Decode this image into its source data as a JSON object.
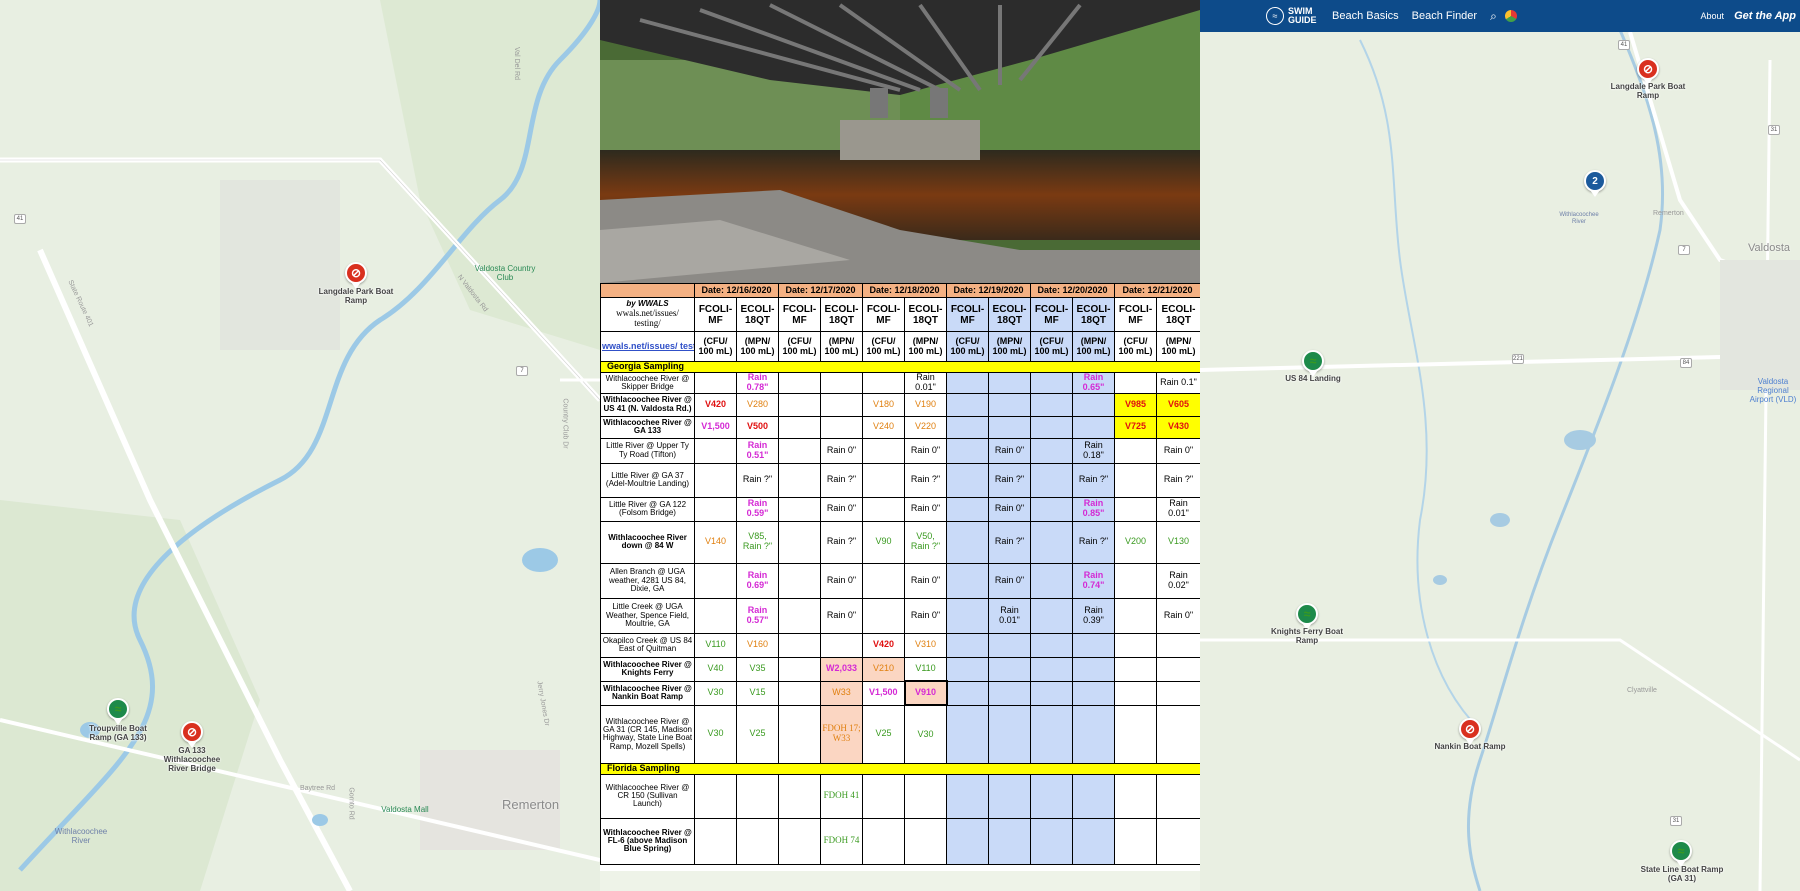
{
  "header": {
    "brand": "SWIM GUIDE",
    "nav": [
      "Beach Basics",
      "Beach Finder"
    ],
    "about": "About",
    "cta": "Get the App"
  },
  "map_left": {
    "markers": [
      {
        "name": "langdale-park-boat-ramp-marker",
        "label": "Langdale Park Boat Ramp",
        "status": "red"
      },
      {
        "name": "troupville-boat-ramp-marker",
        "label": "Troupville Boat Ramp (GA 133)",
        "status": "green"
      },
      {
        "name": "ga133-marker",
        "label": "GA 133 Withlacoochee River Bridge",
        "status": "red"
      }
    ],
    "places": {
      "remerton": "Remerton",
      "river": "Withlacoochee River",
      "mall": "Valdosta Mall",
      "club": "Valdosta Country Club"
    },
    "roads": [
      "N Valdosta Rd",
      "State Route 401",
      "Baytree Rd",
      "Gornto Rd",
      "Jerry Jones Dr",
      "Country Club Dr",
      "Val Del Rd"
    ],
    "shields": [
      "41",
      "7",
      "41"
    ]
  },
  "map_right": {
    "markers": [
      {
        "name": "langdale-park-marker",
        "label": "Langdale Park Boat Ramp",
        "status": "red"
      },
      {
        "name": "cluster-marker",
        "label": "2",
        "status": "blue"
      },
      {
        "name": "us84-landing-marker",
        "label": "US 84 Landing",
        "status": "green"
      },
      {
        "name": "knights-ferry-marker",
        "label": "Knights Ferry Boat Ramp",
        "status": "green"
      },
      {
        "name": "nankin-marker",
        "label": "Nankin Boat Ramp",
        "status": "red"
      },
      {
        "name": "state-line-marker",
        "label": "State Line Boat Ramp (GA 31)",
        "status": "green"
      }
    ],
    "places": {
      "valdosta": "Valdosta",
      "remerton": "Remerton",
      "clyattville": "Clyattville",
      "airport": "Valdosta Regional Airport (VLD)",
      "withla": "Withlacoochee River"
    },
    "shields": [
      "41",
      "31",
      "7",
      "221",
      "84",
      "31"
    ]
  },
  "table": {
    "by": "by WWALS",
    "site": "wwals.net/issues/ testing/",
    "link": "wwals.net/issues/ testing/",
    "dates": [
      "Date:  12/16/2020",
      "Date:  12/17/2020",
      "Date:  12/18/2020",
      "Date:  12/19/2020",
      "Date:  12/20/2020",
      "Date:  12/21/2020"
    ],
    "col_headers": [
      "FCOLI-MF",
      "ECOLI-18QT"
    ],
    "units": [
      "(CFU/ 100 mL)",
      "(MPN/ 100 mL)"
    ],
    "georgia": "Georgia Sampling",
    "florida": "Florida Sampling",
    "rows": [
      {
        "site": "Withlacoochee River @ Skipper Bridge",
        "cells": [
          "",
          "Rain 0.78\"",
          "",
          "",
          "",
          "Rain 0.01\"",
          "",
          "",
          "",
          "Rain 0.65\"",
          "",
          "Rain 0.1\""
        ]
      },
      {
        "site": "Withlacoochee River @ US 41 (N. Valdosta Rd.)",
        "cells": [
          "V420",
          "V280",
          "",
          "",
          "V180",
          "V190",
          "",
          "",
          "",
          "",
          "V985",
          "V605"
        ]
      },
      {
        "site": "Withlacoochee River @ GA 133",
        "cells": [
          "V1,500",
          "V500",
          "",
          "",
          "V240",
          "V220",
          "",
          "",
          "",
          "",
          "V725",
          "V430"
        ]
      },
      {
        "site": "Little River @ Upper Ty Ty Road (Tifton)",
        "cells": [
          "",
          "Rain 0.51\"",
          "",
          "Rain 0\"",
          "",
          "Rain 0\"",
          "",
          "Rain 0\"",
          "",
          "Rain 0.18\"",
          "",
          "Rain 0\""
        ]
      },
      {
        "site": "Little River @ GA 37 (Adel-Moultrie Landing)",
        "cells": [
          "",
          "Rain ?\"",
          "",
          "Rain ?\"",
          "",
          "Rain ?\"",
          "",
          "Rain ?\"",
          "",
          "Rain ?\"",
          "",
          "Rain ?\""
        ]
      },
      {
        "site": "Little River @ GA 122 (Folsom Bridge)",
        "cells": [
          "",
          "Rain 0.59\"",
          "",
          "Rain 0\"",
          "",
          "Rain 0\"",
          "",
          "Rain 0\"",
          "",
          "Rain 0.85\"",
          "",
          "Rain 0.01\""
        ]
      },
      {
        "site": "Withlacoochee River down @ 84 W",
        "cells": [
          "V140",
          "V85, Rain ?\"",
          "",
          "Rain ?\"",
          "V90",
          "V50, Rain ?\"",
          "",
          "Rain ?\"",
          "",
          "Rain ?\"",
          "V200",
          "V130"
        ]
      },
      {
        "site": "Allen Branch @ UGA weather, 4281 US 84, Dixie, GA",
        "cells": [
          "",
          "Rain 0.69\"",
          "",
          "Rain 0\"",
          "",
          "Rain 0\"",
          "",
          "Rain 0\"",
          "",
          "Rain 0.74\"",
          "",
          "Rain 0.02\""
        ]
      },
      {
        "site": "Little Creek @ UGA Weather, Spence Field, Moultrie, GA",
        "cells": [
          "",
          "Rain 0.57\"",
          "",
          "Rain 0\"",
          "",
          "Rain 0\"",
          "",
          "Rain 0.01\"",
          "",
          "Rain 0.39\"",
          "",
          "Rain 0\""
        ]
      },
      {
        "site": "Okapilco Creek @ US 84 East of Quitman",
        "cells": [
          "V110",
          "V160",
          "",
          "",
          "V420",
          "V310",
          "",
          "",
          "",
          "",
          "",
          ""
        ]
      },
      {
        "site": "Withlacoochee River @ Knights Ferry",
        "cells": [
          "V40",
          "V35",
          "",
          "W2,033",
          "V210",
          "V110",
          "",
          "",
          "",
          "",
          "",
          ""
        ]
      },
      {
        "site": "Withlacoochee River @ Nankin Boat Ramp",
        "cells": [
          "V30",
          "V15",
          "",
          "W33",
          "V1,500",
          "V910",
          "",
          "",
          "",
          "",
          "",
          ""
        ]
      },
      {
        "site": "Withlacoochee River @ GA 31 (CR 145, Madison Highway, State Line Boat Ramp, Mozell Spells)",
        "cells": [
          "V30",
          "V25",
          "",
          "FDOH 17; W33",
          "V25",
          "V30",
          "",
          "",
          "",
          "",
          "",
          ""
        ]
      }
    ],
    "fl_rows": [
      {
        "site": "Withlacoochee River @ CR 150 (Sullivan Launch)",
        "cells": [
          "",
          "",
          "",
          "FDOH 41",
          "",
          "",
          "",
          "",
          "",
          "",
          "",
          ""
        ]
      },
      {
        "site": "Withlacoochee River @ FL-6 (above Madison Blue Spring)",
        "cells": [
          "",
          "",
          "",
          "FDOH 74",
          "",
          "",
          "",
          "",
          "",
          "",
          "",
          ""
        ]
      }
    ]
  }
}
